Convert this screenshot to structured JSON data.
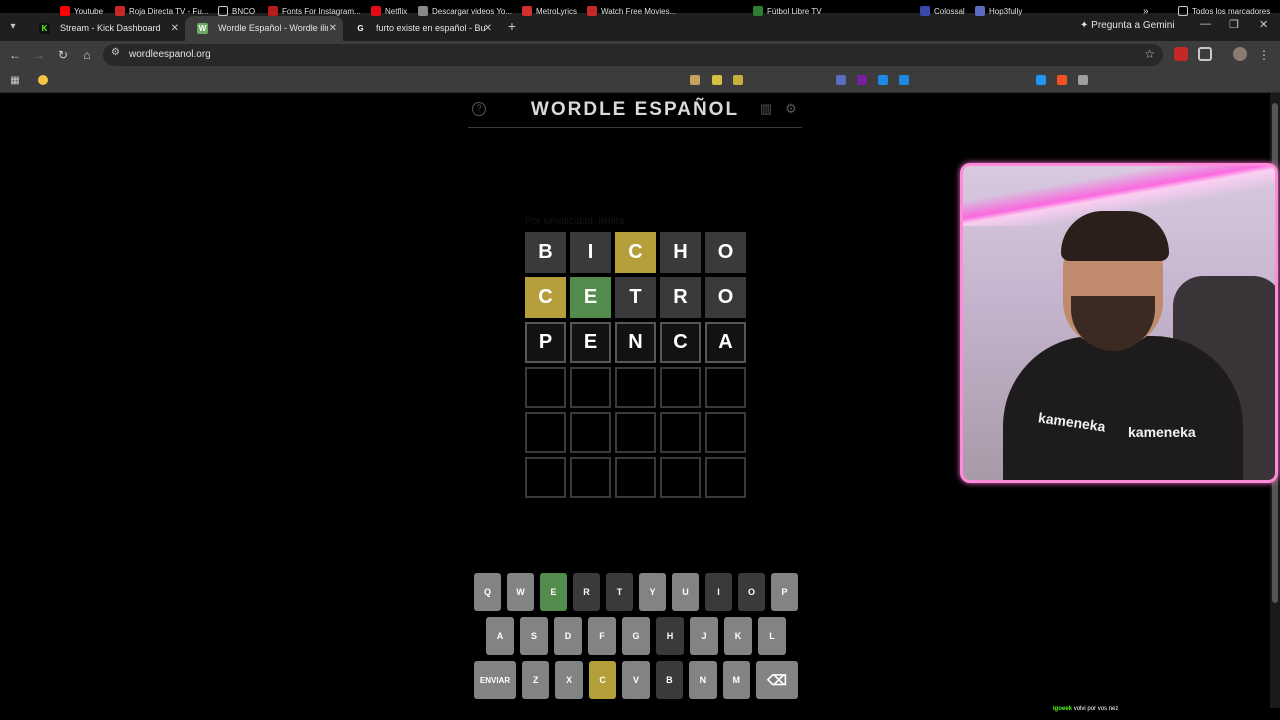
{
  "browser": {
    "tabs": [
      {
        "label": "Stream - Kick Dashboard",
        "favicon": "K",
        "color": "#53fc18",
        "active": false
      },
      {
        "label": "Wordle Español - Wordle ilimitado",
        "favicon": "W",
        "color": "#6aaa64",
        "active": true
      },
      {
        "label": "furto existe en español - Buscar",
        "favicon": "G",
        "color": "#ffffff",
        "active": false
      }
    ],
    "gemini_label": "Pregunta a Gemini",
    "url": "wordleespanol.org"
  },
  "bookmarks": {
    "items": [
      "Youtube",
      "Roja Directa TV - Fu...",
      "BNCO",
      "Fonts For Instagram...",
      "Netflix",
      "Descargar videos Yo...",
      "MetroLyrics",
      "Watch Free Movies...",
      "Fútbol Libre TV",
      "Colossal",
      "Hop3fully"
    ],
    "all_bookmarks": "Todos los marcadores"
  },
  "game": {
    "title": "WORDLE ESPAÑOL",
    "hidden_message": "Por simplicidad, ilimita",
    "board": [
      [
        {
          "l": "B",
          "s": "absent"
        },
        {
          "l": "I",
          "s": "absent"
        },
        {
          "l": "C",
          "s": "present"
        },
        {
          "l": "H",
          "s": "absent"
        },
        {
          "l": "O",
          "s": "absent"
        }
      ],
      [
        {
          "l": "C",
          "s": "present"
        },
        {
          "l": "E",
          "s": "correct"
        },
        {
          "l": "T",
          "s": "absent"
        },
        {
          "l": "R",
          "s": "absent"
        },
        {
          "l": "O",
          "s": "absent"
        }
      ],
      [
        {
          "l": "P",
          "s": "filled"
        },
        {
          "l": "E",
          "s": "filled"
        },
        {
          "l": "N",
          "s": "filled"
        },
        {
          "l": "C",
          "s": "filled"
        },
        {
          "l": "A",
          "s": "filled"
        }
      ],
      [
        {
          "l": "",
          "s": "empty"
        },
        {
          "l": "",
          "s": "empty"
        },
        {
          "l": "",
          "s": "empty"
        },
        {
          "l": "",
          "s": "empty"
        },
        {
          "l": "",
          "s": "empty"
        }
      ],
      [
        {
          "l": "",
          "s": "empty"
        },
        {
          "l": "",
          "s": "empty"
        },
        {
          "l": "",
          "s": "empty"
        },
        {
          "l": "",
          "s": "empty"
        },
        {
          "l": "",
          "s": "empty"
        }
      ],
      [
        {
          "l": "",
          "s": "empty"
        },
        {
          "l": "",
          "s": "empty"
        },
        {
          "l": "",
          "s": "empty"
        },
        {
          "l": "",
          "s": "empty"
        },
        {
          "l": "",
          "s": "empty"
        }
      ]
    ],
    "keyboard": [
      [
        {
          "k": "Q",
          "s": ""
        },
        {
          "k": "W",
          "s": ""
        },
        {
          "k": "E",
          "s": "correct"
        },
        {
          "k": "R",
          "s": "absent"
        },
        {
          "k": "T",
          "s": "absent"
        },
        {
          "k": "Y",
          "s": ""
        },
        {
          "k": "U",
          "s": ""
        },
        {
          "k": "I",
          "s": "absent"
        },
        {
          "k": "O",
          "s": "absent"
        },
        {
          "k": "P",
          "s": ""
        }
      ],
      [
        {
          "k": "A",
          "s": ""
        },
        {
          "k": "S",
          "s": ""
        },
        {
          "k": "D",
          "s": ""
        },
        {
          "k": "F",
          "s": ""
        },
        {
          "k": "G",
          "s": ""
        },
        {
          "k": "H",
          "s": "absent"
        },
        {
          "k": "J",
          "s": ""
        },
        {
          "k": "K",
          "s": ""
        },
        {
          "k": "L",
          "s": ""
        }
      ],
      [
        {
          "k": "ENVIAR",
          "s": "",
          "wide": true
        },
        {
          "k": "Z",
          "s": ""
        },
        {
          "k": "X",
          "s": ""
        },
        {
          "k": "C",
          "s": "present"
        },
        {
          "k": "V",
          "s": ""
        },
        {
          "k": "B",
          "s": "absent"
        },
        {
          "k": "N",
          "s": ""
        },
        {
          "k": "M",
          "s": ""
        },
        {
          "k": "⌫",
          "s": "",
          "wide": true
        }
      ]
    ]
  },
  "overlay": {
    "webcam_logo": "kameneka",
    "chat_user": "lgoeek",
    "chat_message": "volvi por vos nez"
  }
}
